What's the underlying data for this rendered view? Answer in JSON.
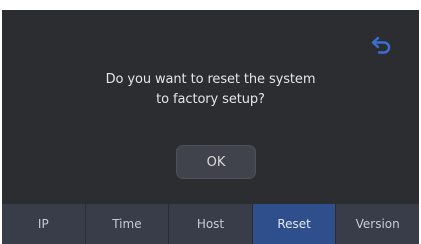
{
  "dialog": {
    "message_line1": "Do you want to reset the system",
    "message_line2": "to factory setup?",
    "ok_label": "OK"
  },
  "header": {
    "back_icon": "back-arrow-icon"
  },
  "tabs": [
    {
      "label": "IP",
      "active": false
    },
    {
      "label": "Time",
      "active": false
    },
    {
      "label": "Host",
      "active": false
    },
    {
      "label": "Reset",
      "active": true
    },
    {
      "label": "Version",
      "active": false
    }
  ],
  "colors": {
    "background": "#2b2d31",
    "tab_bar": "#393c49",
    "active_tab": "#2e4f8c",
    "back_icon": "#3b6fd6"
  }
}
